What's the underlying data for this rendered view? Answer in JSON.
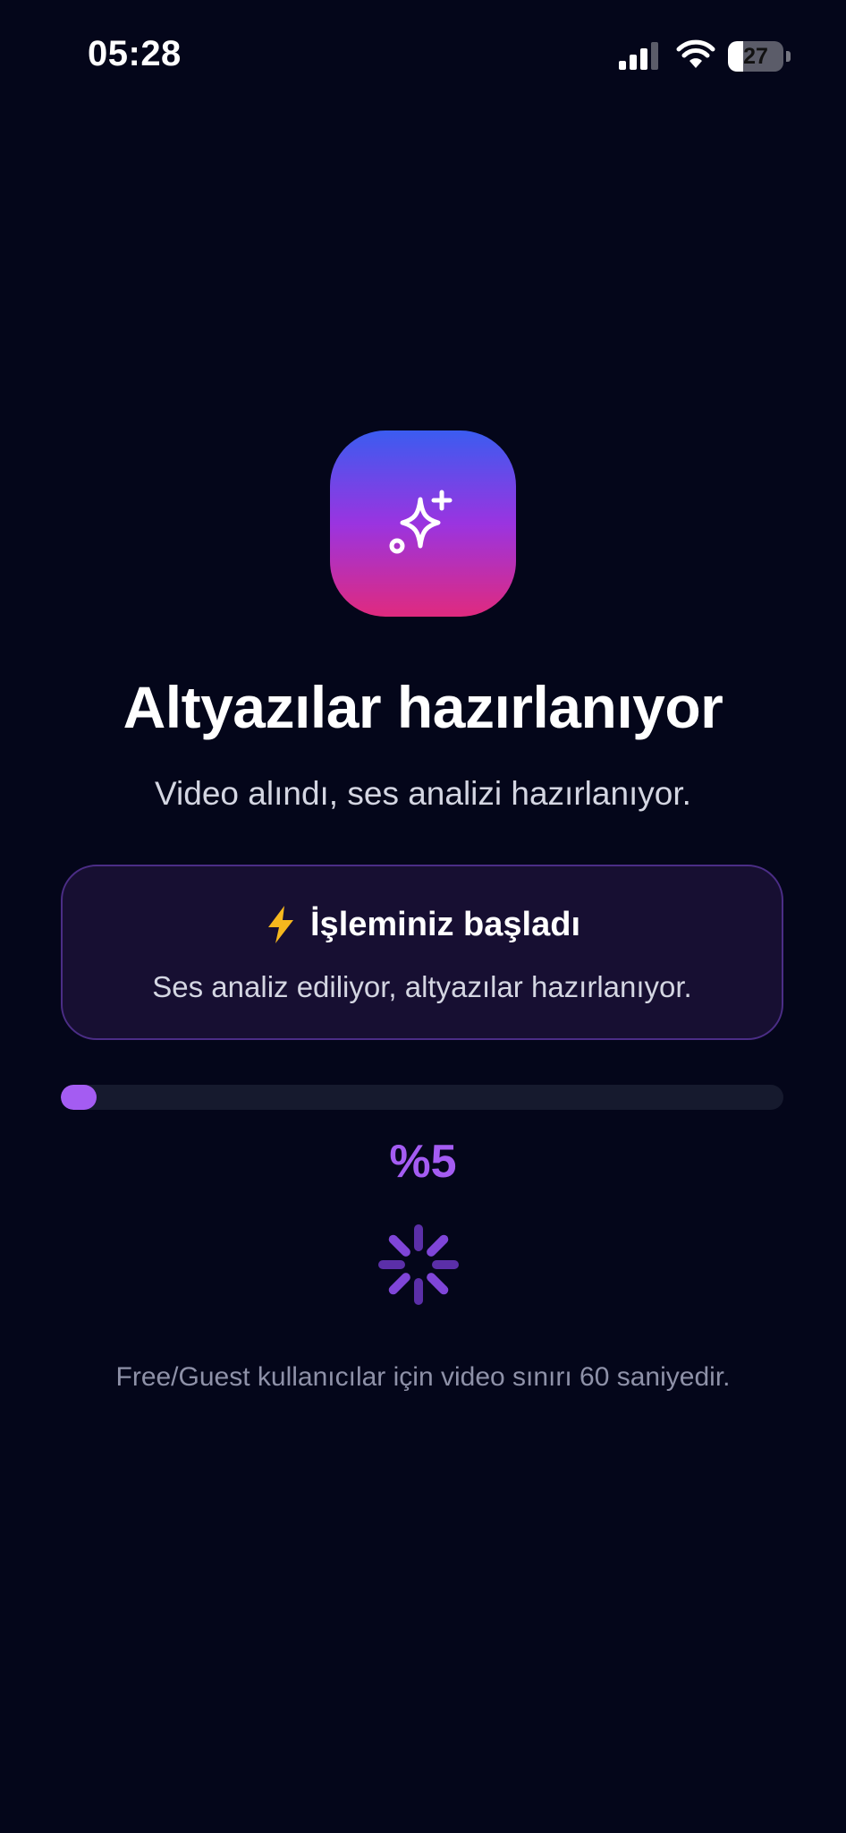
{
  "status_bar": {
    "time": "05:28",
    "battery_level": "27",
    "battery_fraction": 0.27,
    "icons": [
      "signal-icon",
      "wifi-icon",
      "battery-icon"
    ]
  },
  "app_icon": {
    "icon": "sparkle-icon",
    "gradient": [
      "#3b5cf0",
      "#9a34e0",
      "#e02a7e"
    ]
  },
  "header": {
    "title": "Altyazılar hazırlanıyor",
    "subtitle": "Video alındı, ses analizi hazırlanıyor."
  },
  "status_card": {
    "icon": "lightning-bolt-icon",
    "title": "İşleminiz başladı",
    "text": "Ses analiz ediliyor, altyazılar hazırlanıyor."
  },
  "progress": {
    "value": 0.05,
    "label": "%5"
  },
  "loader": {
    "icon": "spinner-icon"
  },
  "footer": {
    "note": "Free/Guest kullanıcılar için video sınırı 60 saniyedir."
  },
  "colors": {
    "background": "#04061a",
    "accent": "#a45cf2",
    "card_background": "#170f32",
    "card_border": "#4b2d86",
    "track": "#161a2e"
  }
}
